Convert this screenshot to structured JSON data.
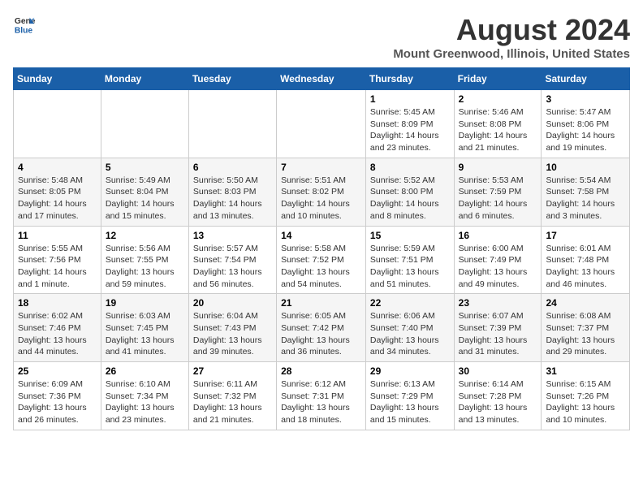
{
  "header": {
    "logo_line1": "General",
    "logo_line2": "Blue",
    "title": "August 2024",
    "subtitle": "Mount Greenwood, Illinois, United States"
  },
  "weekdays": [
    "Sunday",
    "Monday",
    "Tuesday",
    "Wednesday",
    "Thursday",
    "Friday",
    "Saturday"
  ],
  "weeks": [
    [
      {
        "day": "",
        "info": ""
      },
      {
        "day": "",
        "info": ""
      },
      {
        "day": "",
        "info": ""
      },
      {
        "day": "",
        "info": ""
      },
      {
        "day": "1",
        "info": "Sunrise: 5:45 AM\nSunset: 8:09 PM\nDaylight: 14 hours\nand 23 minutes."
      },
      {
        "day": "2",
        "info": "Sunrise: 5:46 AM\nSunset: 8:08 PM\nDaylight: 14 hours\nand 21 minutes."
      },
      {
        "day": "3",
        "info": "Sunrise: 5:47 AM\nSunset: 8:06 PM\nDaylight: 14 hours\nand 19 minutes."
      }
    ],
    [
      {
        "day": "4",
        "info": "Sunrise: 5:48 AM\nSunset: 8:05 PM\nDaylight: 14 hours\nand 17 minutes."
      },
      {
        "day": "5",
        "info": "Sunrise: 5:49 AM\nSunset: 8:04 PM\nDaylight: 14 hours\nand 15 minutes."
      },
      {
        "day": "6",
        "info": "Sunrise: 5:50 AM\nSunset: 8:03 PM\nDaylight: 14 hours\nand 13 minutes."
      },
      {
        "day": "7",
        "info": "Sunrise: 5:51 AM\nSunset: 8:02 PM\nDaylight: 14 hours\nand 10 minutes."
      },
      {
        "day": "8",
        "info": "Sunrise: 5:52 AM\nSunset: 8:00 PM\nDaylight: 14 hours\nand 8 minutes."
      },
      {
        "day": "9",
        "info": "Sunrise: 5:53 AM\nSunset: 7:59 PM\nDaylight: 14 hours\nand 6 minutes."
      },
      {
        "day": "10",
        "info": "Sunrise: 5:54 AM\nSunset: 7:58 PM\nDaylight: 14 hours\nand 3 minutes."
      }
    ],
    [
      {
        "day": "11",
        "info": "Sunrise: 5:55 AM\nSunset: 7:56 PM\nDaylight: 14 hours\nand 1 minute."
      },
      {
        "day": "12",
        "info": "Sunrise: 5:56 AM\nSunset: 7:55 PM\nDaylight: 13 hours\nand 59 minutes."
      },
      {
        "day": "13",
        "info": "Sunrise: 5:57 AM\nSunset: 7:54 PM\nDaylight: 13 hours\nand 56 minutes."
      },
      {
        "day": "14",
        "info": "Sunrise: 5:58 AM\nSunset: 7:52 PM\nDaylight: 13 hours\nand 54 minutes."
      },
      {
        "day": "15",
        "info": "Sunrise: 5:59 AM\nSunset: 7:51 PM\nDaylight: 13 hours\nand 51 minutes."
      },
      {
        "day": "16",
        "info": "Sunrise: 6:00 AM\nSunset: 7:49 PM\nDaylight: 13 hours\nand 49 minutes."
      },
      {
        "day": "17",
        "info": "Sunrise: 6:01 AM\nSunset: 7:48 PM\nDaylight: 13 hours\nand 46 minutes."
      }
    ],
    [
      {
        "day": "18",
        "info": "Sunrise: 6:02 AM\nSunset: 7:46 PM\nDaylight: 13 hours\nand 44 minutes."
      },
      {
        "day": "19",
        "info": "Sunrise: 6:03 AM\nSunset: 7:45 PM\nDaylight: 13 hours\nand 41 minutes."
      },
      {
        "day": "20",
        "info": "Sunrise: 6:04 AM\nSunset: 7:43 PM\nDaylight: 13 hours\nand 39 minutes."
      },
      {
        "day": "21",
        "info": "Sunrise: 6:05 AM\nSunset: 7:42 PM\nDaylight: 13 hours\nand 36 minutes."
      },
      {
        "day": "22",
        "info": "Sunrise: 6:06 AM\nSunset: 7:40 PM\nDaylight: 13 hours\nand 34 minutes."
      },
      {
        "day": "23",
        "info": "Sunrise: 6:07 AM\nSunset: 7:39 PM\nDaylight: 13 hours\nand 31 minutes."
      },
      {
        "day": "24",
        "info": "Sunrise: 6:08 AM\nSunset: 7:37 PM\nDaylight: 13 hours\nand 29 minutes."
      }
    ],
    [
      {
        "day": "25",
        "info": "Sunrise: 6:09 AM\nSunset: 7:36 PM\nDaylight: 13 hours\nand 26 minutes."
      },
      {
        "day": "26",
        "info": "Sunrise: 6:10 AM\nSunset: 7:34 PM\nDaylight: 13 hours\nand 23 minutes."
      },
      {
        "day": "27",
        "info": "Sunrise: 6:11 AM\nSunset: 7:32 PM\nDaylight: 13 hours\nand 21 minutes."
      },
      {
        "day": "28",
        "info": "Sunrise: 6:12 AM\nSunset: 7:31 PM\nDaylight: 13 hours\nand 18 minutes."
      },
      {
        "day": "29",
        "info": "Sunrise: 6:13 AM\nSunset: 7:29 PM\nDaylight: 13 hours\nand 15 minutes."
      },
      {
        "day": "30",
        "info": "Sunrise: 6:14 AM\nSunset: 7:28 PM\nDaylight: 13 hours\nand 13 minutes."
      },
      {
        "day": "31",
        "info": "Sunrise: 6:15 AM\nSunset: 7:26 PM\nDaylight: 13 hours\nand 10 minutes."
      }
    ]
  ]
}
